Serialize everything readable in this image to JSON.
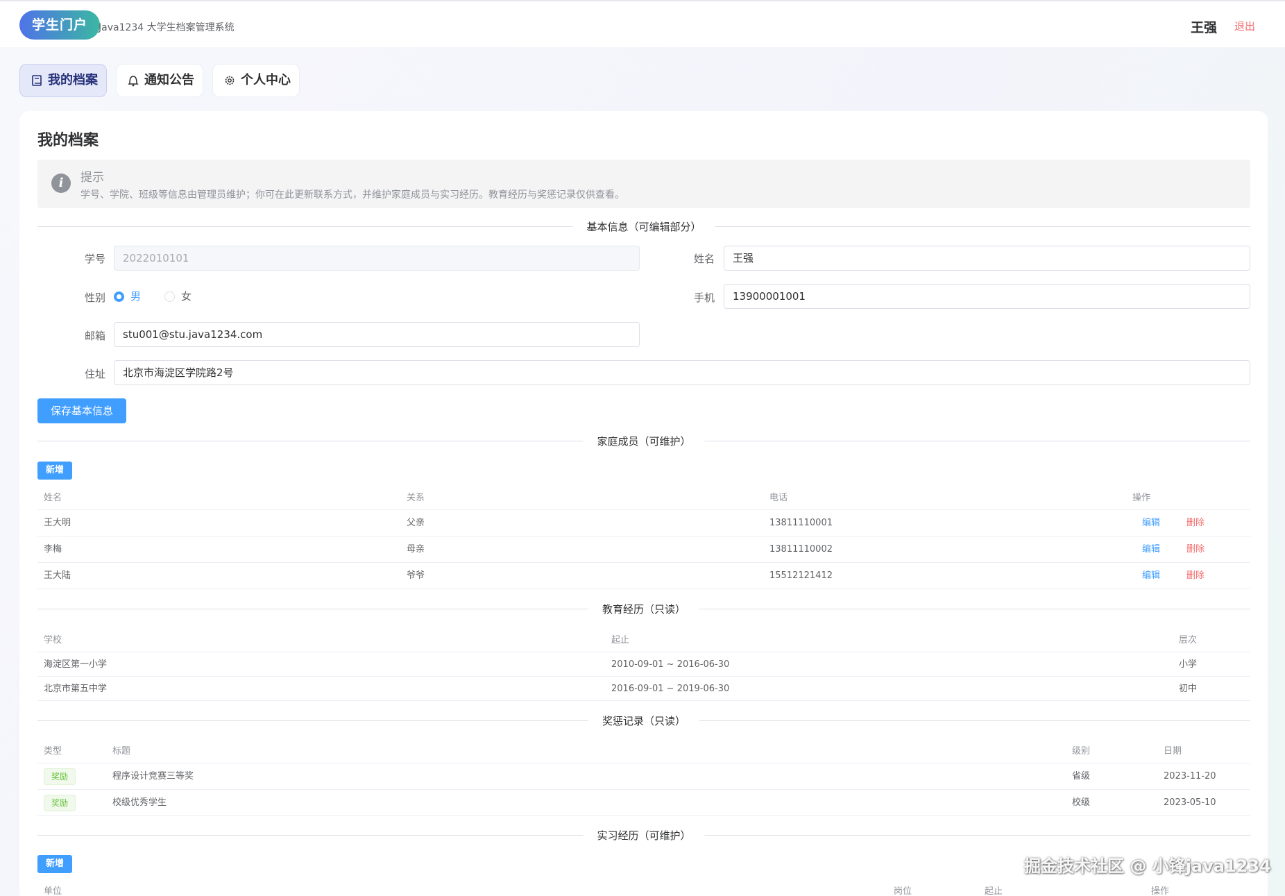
{
  "header": {
    "logo_text": "学生门户",
    "subtitle": "Java1234 大学生档案管理系统",
    "username": "王强",
    "logout_label": "退出"
  },
  "tabs": [
    {
      "label": "我的档案",
      "icon": "book-icon",
      "active": true
    },
    {
      "label": "通知公告",
      "icon": "bell-icon",
      "active": false
    },
    {
      "label": "个人中心",
      "icon": "gear-icon",
      "active": false
    }
  ],
  "page_title": "我的档案",
  "alert": {
    "title": "提示",
    "description": "学号、学院、班级等信息由管理员维护；你可在此更新联系方式，并维护家庭成员与实习经历。教育经历与奖惩记录仅供查看。"
  },
  "basic_info": {
    "section_title": "基本信息（可编辑部分）",
    "student_id_label": "学号",
    "student_id_value": "2022010101",
    "name_label": "姓名",
    "name_value": "王强",
    "gender_label": "性别",
    "gender_options": [
      "男",
      "女"
    ],
    "gender_selected": "男",
    "phone_label": "手机",
    "phone_value": "13900001001",
    "email_label": "邮箱",
    "email_value": "stu001@stu.java1234.com",
    "address_label": "住址",
    "address_value": "北京市海淀区学院路2号",
    "save_button": "保存基本信息"
  },
  "family": {
    "section_title": "家庭成员（可维护）",
    "add_button": "新增",
    "columns": [
      "姓名",
      "关系",
      "电话",
      "操作"
    ],
    "edit_label": "编辑",
    "delete_label": "删除",
    "rows": [
      {
        "name": "王大明",
        "relation": "父亲",
        "phone": "13811110001"
      },
      {
        "name": "李梅",
        "relation": "母亲",
        "phone": "13811110002"
      },
      {
        "name": "王大陆",
        "relation": "爷爷",
        "phone": "15512121412"
      }
    ]
  },
  "education": {
    "section_title": "教育经历（只读）",
    "columns": [
      "学校",
      "起止",
      "层次"
    ],
    "rows": [
      {
        "school": "海淀区第一小学",
        "period": "2010-09-01 ~ 2016-06-30",
        "level": "小学"
      },
      {
        "school": "北京市第五中学",
        "period": "2016-09-01 ~ 2019-06-30",
        "level": "初中"
      }
    ]
  },
  "rewards": {
    "section_title": "奖惩记录（只读）",
    "columns": [
      "类型",
      "标题",
      "级别",
      "日期"
    ],
    "rows": [
      {
        "type": "奖励",
        "title": "程序设计竞赛三等奖",
        "level": "省级",
        "date": "2023-11-20"
      },
      {
        "type": "奖励",
        "title": "校级优秀学生",
        "level": "校级",
        "date": "2023-05-10"
      }
    ]
  },
  "internship": {
    "section_title": "实习经历（可维护）",
    "add_button": "新增",
    "columns": [
      "单位",
      "岗位",
      "起止",
      "操作"
    ]
  },
  "watermark": "掘金技术社区 @ 小锋java1234",
  "colors": {
    "primary": "#409eff",
    "danger": "#f56c6c",
    "success": "#67c23a",
    "logo_start": "#4f73e8",
    "logo_end": "#3bb7a1"
  }
}
